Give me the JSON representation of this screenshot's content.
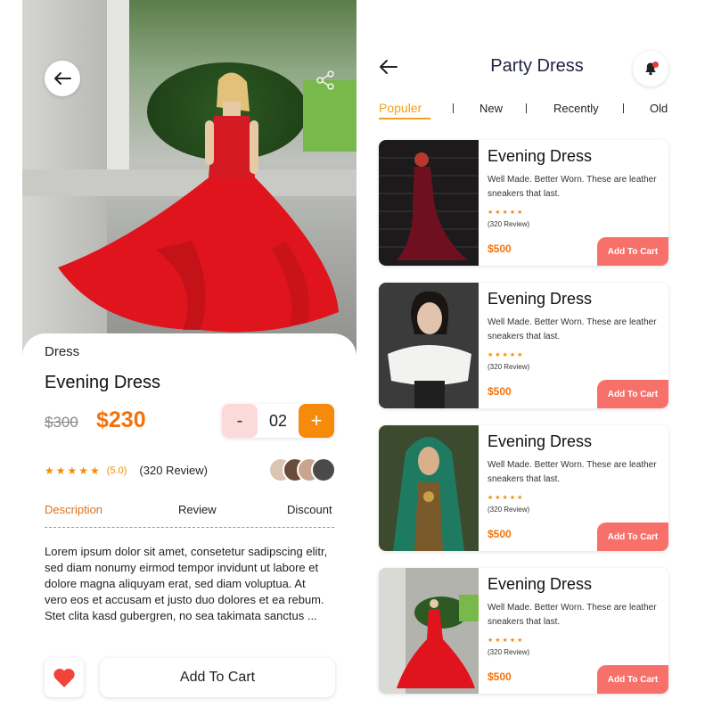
{
  "detail": {
    "category": "Dress",
    "name": "Evening Dress",
    "old_price": "$300",
    "price": "$230",
    "quantity": {
      "minus": "-",
      "value": "02",
      "plus": "+"
    },
    "rating": {
      "stars": "★★★★★",
      "value": "(5.0)",
      "reviews": "(320 Review)"
    },
    "tabs": [
      {
        "label": "Description",
        "active": true
      },
      {
        "label": "Review",
        "active": false
      },
      {
        "label": "Discount",
        "active": false
      }
    ],
    "description": "Lorem ipsum dolor sit amet, consetetur sadipscing elitr, sed diam nonumy eirmod tempor invidunt ut labore et dolore magna aliquyam erat, sed diam voluptua. At vero eos et accusam et justo duo dolores et ea rebum. Stet clita kasd gubergren, no sea takimata sanctus ...",
    "add_to_cart": "Add To Cart",
    "icons": {
      "back": "arrow-left-icon",
      "share": "share-icon",
      "favorite": "heart-icon"
    }
  },
  "list": {
    "title": "Party Dress",
    "filters": [
      {
        "label": "Populer",
        "active": true
      },
      {
        "label": "New",
        "active": false
      },
      {
        "label": "Recently",
        "active": false
      },
      {
        "label": "Old",
        "active": false
      }
    ],
    "items": [
      {
        "title": "Evening Dress",
        "description": "Well Made. Better Worn. These are leather sneakers that last.",
        "stars": "★★★★★",
        "reviews": "(320 Review)",
        "price": "$500",
        "cta": "Add To Cart"
      },
      {
        "title": "Evening Dress",
        "description": "Well Made. Better Worn. These are leather sneakers that last.",
        "stars": "★★★★★",
        "reviews": "(320 Review)",
        "price": "$500",
        "cta": "Add To Cart"
      },
      {
        "title": "Evening Dress",
        "description": "Well Made. Better Worn. These are leather sneakers that last.",
        "stars": "★★★★★",
        "reviews": "(320 Review)",
        "price": "$500",
        "cta": "Add To Cart"
      },
      {
        "title": "Evening Dress",
        "description": "Well Made. Better Worn. These are leather sneakers that last.",
        "stars": "★★★★★",
        "reviews": "(320 Review)",
        "price": "$500",
        "cta": "Add To Cart"
      }
    ],
    "icons": {
      "back": "arrow-left-icon",
      "notification": "bell-icon"
    }
  },
  "colors": {
    "accent": "#f58a0b",
    "price": "#f2720c",
    "cart_button": "#f8706a",
    "filter_active": "#f2a21a"
  }
}
